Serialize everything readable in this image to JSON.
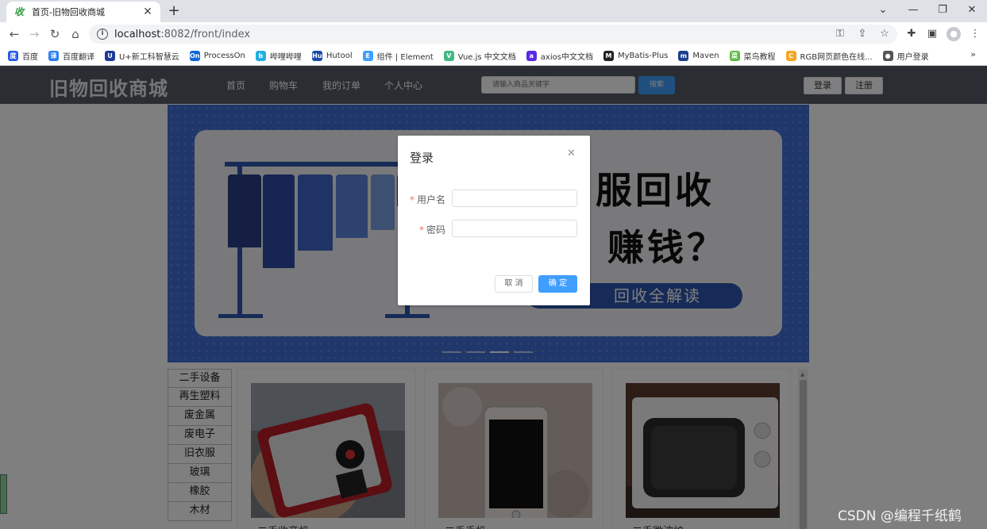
{
  "browser": {
    "tab_title": "首页-旧物回收商城",
    "tab_favicon": "收",
    "url_host": "localhost",
    "url_rest": ":8082/front/index",
    "bookmarks": [
      {
        "label": "百度",
        "color": "#2b5ce6",
        "icon": "度"
      },
      {
        "label": "百度翻译",
        "color": "#2b7de9",
        "icon": "译"
      },
      {
        "label": "U+新工科智慧云",
        "color": "#1d3b9a",
        "icon": "U"
      },
      {
        "label": "ProcessOn",
        "color": "#0f67d6",
        "icon": "On"
      },
      {
        "label": "哔哩哔哩",
        "color": "#23ade5",
        "icon": "b"
      },
      {
        "label": "Hutool",
        "color": "#1b4aa8",
        "icon": "Hu"
      },
      {
        "label": "组件 | Element",
        "color": "#409eff",
        "icon": "E"
      },
      {
        "label": "Vue.js 中文文档",
        "color": "#42b883",
        "icon": "V"
      },
      {
        "label": "axios中文文档",
        "color": "#5a29e4",
        "icon": "a"
      },
      {
        "label": "MyBatis-Plus",
        "color": "#222222",
        "icon": "M"
      },
      {
        "label": "Maven",
        "color": "#1b3f8b",
        "icon": "m"
      },
      {
        "label": "菜鸟教程",
        "color": "#5fb846",
        "icon": "菜"
      },
      {
        "label": "RGB网页颜色在线...",
        "color": "#f5a623",
        "icon": "C"
      },
      {
        "label": "用户登录",
        "color": "#555555",
        "icon": "●"
      }
    ],
    "bookmarks_more": "»"
  },
  "header": {
    "logo": "旧物回收商城",
    "nav": [
      "首页",
      "购物车",
      "我的订单",
      "个人中心"
    ],
    "search_placeholder": "请输入商品关键字",
    "search_button": "搜索",
    "login_button": "登录",
    "register_button": "注册"
  },
  "banner": {
    "line1": "服回收",
    "line2": "赚钱？",
    "pill": "回收全解读",
    "slide_count": 4,
    "active_slide": 3
  },
  "categories": [
    "二手设备",
    "再生塑料",
    "废金属",
    "废电子",
    "旧衣服",
    "玻璃",
    "橡胶",
    "木材"
  ],
  "products": [
    {
      "title": "二手收音机"
    },
    {
      "title": "二手手机"
    },
    {
      "title": "二手微波炉"
    }
  ],
  "login_dialog": {
    "title": "登录",
    "username_label": "用户名",
    "username_value": "",
    "password_label": "密码",
    "password_value": "",
    "cancel_button": "取 消",
    "confirm_button": "确 定"
  },
  "watermark": "CSDN @编程千纸鹤",
  "colors": {
    "header_bg": "#545c64",
    "primary": "#409eff",
    "banner_blue": "#3f6fd6",
    "required": "#f56c6c"
  }
}
